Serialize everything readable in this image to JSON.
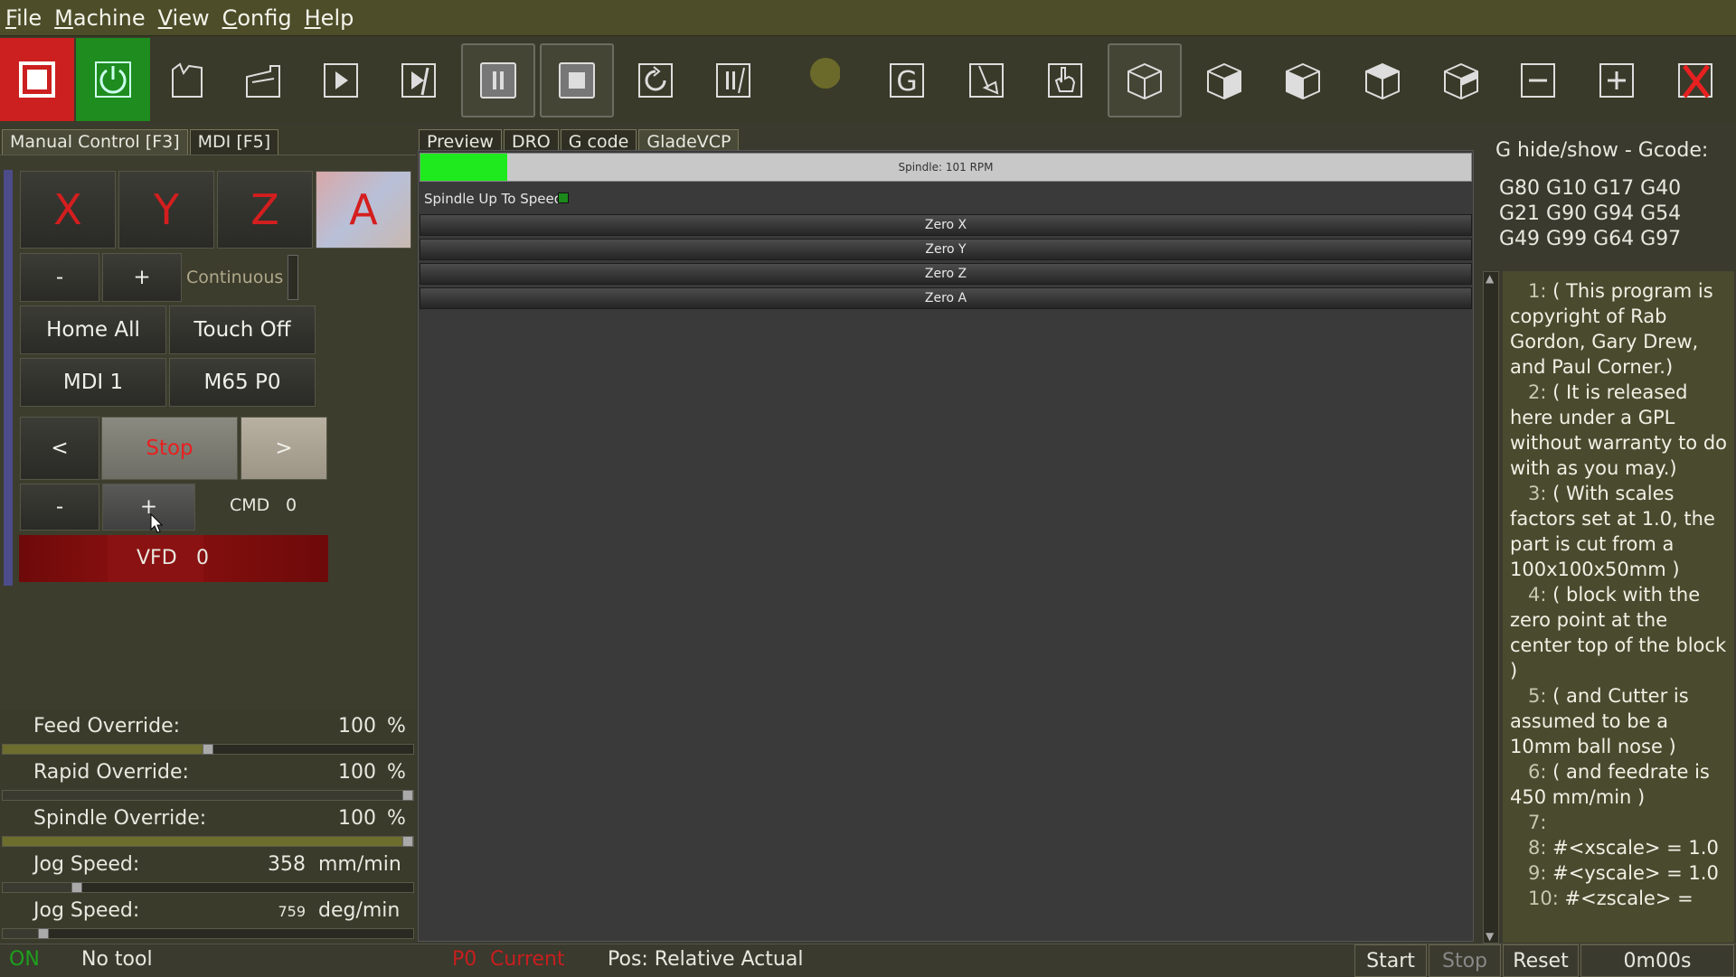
{
  "menu": [
    "File",
    "Machine",
    "View",
    "Config",
    "Help"
  ],
  "toolbar": {
    "estop": "estop-icon",
    "power": "power-icon",
    "g_label": "G"
  },
  "left": {
    "tabs": [
      "Manual Control [F3]",
      "MDI [F5]"
    ],
    "axes": [
      "X",
      "Y",
      "Z",
      "A"
    ],
    "jog_minus": "-",
    "jog_plus": "+",
    "increment": "Continuous",
    "home_all": "Home All",
    "touch_off": "Touch Off",
    "mdi1": "MDI 1",
    "m65": "M65 P0",
    "spindle_rev": "<",
    "spindle_stop": "Stop",
    "spindle_fwd": ">",
    "spd_minus": "-",
    "spd_plus": "+",
    "cmd_label": "CMD",
    "cmd_value": "0",
    "vfd_label": "VFD",
    "vfd_value": "0"
  },
  "overrides": [
    {
      "label": "Feed Override:",
      "value": "100",
      "unit": "%",
      "level": 0.5
    },
    {
      "label": "Rapid Override:",
      "value": "100",
      "unit": "%",
      "level": 1.0
    },
    {
      "label": "Spindle Override:",
      "value": "100",
      "unit": "%",
      "level": 1.0
    },
    {
      "label": "Jog Speed:",
      "value": "358",
      "unit": "mm/min",
      "level": 0.18
    },
    {
      "label": "Jog Speed:",
      "value": "759",
      "unit": "deg/min",
      "level": 0.1
    }
  ],
  "center": {
    "tabs": [
      "Preview",
      "DRO",
      "G code",
      "GladeVCP"
    ],
    "spindle_bar_text": "Spindle:  101 RPM",
    "spindle_level": 0.083,
    "spindle_up_label": "Spindle Up To Speed",
    "zero_buttons": [
      "Zero X",
      "Zero Y",
      "Zero Z",
      "Zero A"
    ]
  },
  "right": {
    "header": "G hide/show - Gcode:",
    "gcodes": [
      "G80 G10 G17 G40",
      "G21 G90 G94 G54",
      "G49 G99 G64 G97"
    ],
    "program": [
      {
        "n": "1:",
        "t": "( This program is copyright of Rab Gordon, Gary Drew, and Paul Corner.)"
      },
      {
        "n": "2:",
        "t": "( It is released here under a GPL without warranty to do with as you may.)"
      },
      {
        "n": "3:",
        "t": "( With scales factors set at 1.0, the part is cut from a 100x100x50mm )"
      },
      {
        "n": "4:",
        "t": "( block with the zero point at the center top of the block )"
      },
      {
        "n": "5:",
        "t": "( and Cutter is assumed to be a 10mm ball nose )"
      },
      {
        "n": "6:",
        "t": "( and feedrate is 450 mm/min )"
      },
      {
        "n": "7:",
        "t": ""
      },
      {
        "n": "8:",
        "t": "#<xscale> = 1.0"
      },
      {
        "n": "9:",
        "t": "#<yscale> = 1.0"
      },
      {
        "n": "10:",
        "t": "#<zscale> ="
      }
    ]
  },
  "status": {
    "state": "ON",
    "tool": "No tool",
    "p0": "P0",
    "current": "Current",
    "pos": "Pos: Relative Actual",
    "start": "Start",
    "stop": "Stop",
    "reset": "Reset",
    "time": "0m00s"
  },
  "colors": {
    "estop_red": "#cc1f1f",
    "power_green": "#1e8c1e",
    "axis_red": "#d41e1e",
    "vfd_dark_red": "#6e0a0a"
  }
}
